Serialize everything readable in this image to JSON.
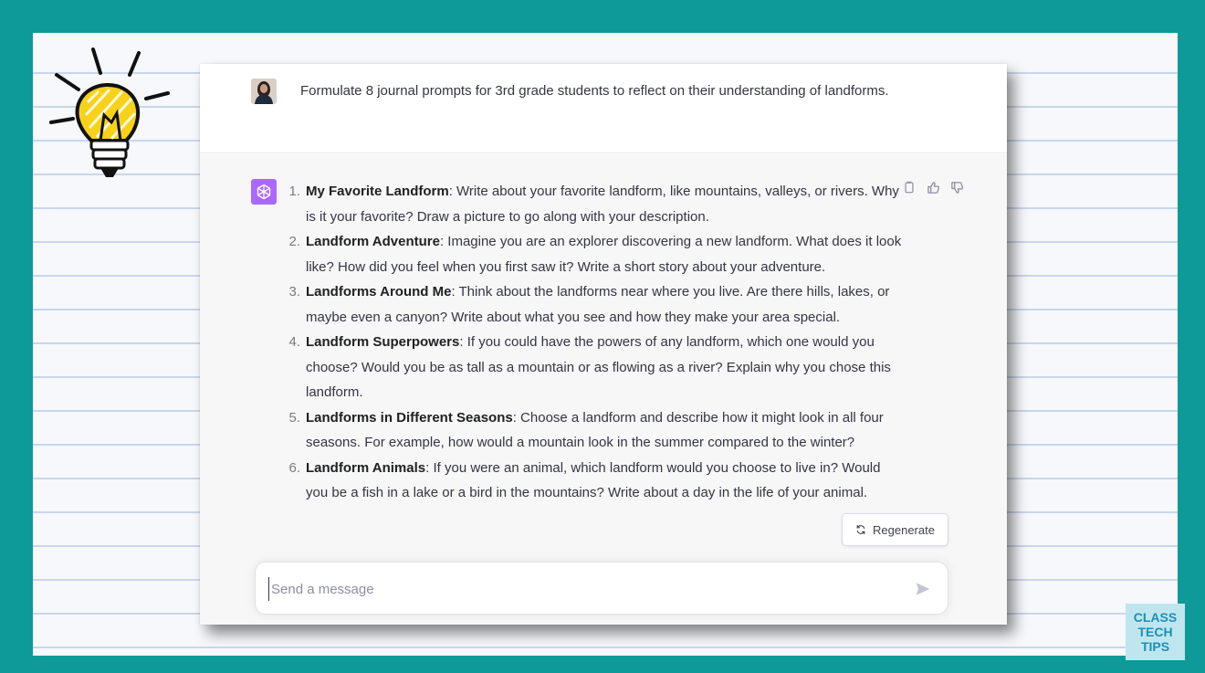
{
  "user_message": {
    "text": "Formulate 8 journal prompts for 3rd grade students to reflect on their understanding of landforms."
  },
  "assistant_message": {
    "items": [
      {
        "num": "1.",
        "title": "My Favorite Landform",
        "body": ": Write about your favorite landform, like mountains, valleys, or rivers. Why is it your favorite? Draw a picture to go along with your description."
      },
      {
        "num": "2.",
        "title": "Landform Adventure",
        "body": ": Imagine you are an explorer discovering a new landform. What does it look like? How did you feel when you first saw it? Write a short story about your adventure."
      },
      {
        "num": "3.",
        "title": "Landforms Around Me",
        "body": ": Think about the landforms near where you live. Are there hills, lakes, or maybe even a canyon? Write about what you see and how they make your area special."
      },
      {
        "num": "4.",
        "title": "Landform Superpowers",
        "body": ": If you could have the powers of any landform, which one would you choose? Would you be as tall as a mountain or as flowing as a river? Explain why you chose this landform."
      },
      {
        "num": "5.",
        "title": "Landforms in Different Seasons",
        "body": ": Choose a landform and describe how it might look in all four seasons. For example, how would a mountain look in the summer compared to the winter?"
      },
      {
        "num": "6.",
        "title": "Landform Animals",
        "body": ": If you were an animal, which landform would you choose to live in? Would you be a fish in a lake or a bird in the mountains? Write about a day in the life of your animal."
      }
    ]
  },
  "regenerate": {
    "label": "Regenerate"
  },
  "composer": {
    "placeholder": "Send a message"
  },
  "brand": {
    "line1": "CLASS",
    "line2": "TECH",
    "line3": "TIPS"
  },
  "colors": {
    "frame": "#0d9a98",
    "gpt_logo": "#ab68ff",
    "brand_text": "#1d8fb9",
    "brand_bg": "#bfe6ee"
  }
}
